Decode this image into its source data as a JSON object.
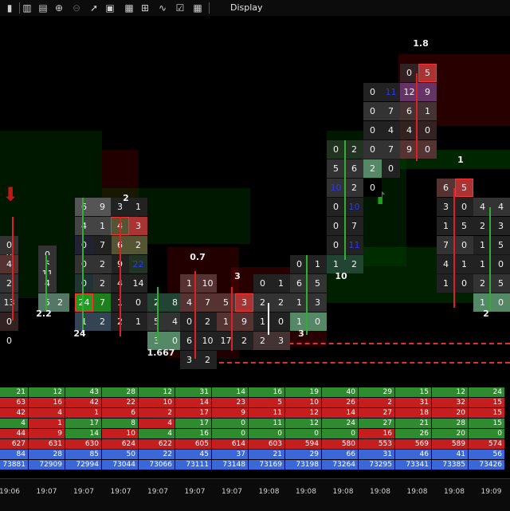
{
  "toolbar": {
    "title": "Display",
    "icons": [
      "bar-chart-icon",
      "zoom-in-icon",
      "zoom-out-icon",
      "pointer-icon",
      "notes-icon",
      "template-icon",
      "drawing-tool-icon",
      "checklist-icon",
      "grid-icon"
    ]
  },
  "colors": {
    "background": "#000000",
    "buy": "#2fae2f",
    "sell": "#e02020",
    "poc_box": "#ff3030",
    "delta_text_blue": "#1c2cff",
    "stat_green": "#2e8b2e",
    "stat_red": "#c41e1e",
    "stat_blue": "#3a68d8"
  },
  "chart": {
    "arrows": [
      {
        "direction": "down",
        "color": "#c01818"
      },
      {
        "direction": "up",
        "color": "#1fa01f"
      }
    ],
    "labels": [
      "1.8",
      "2",
      "0.7",
      "3",
      "2.2",
      "24",
      "1.667",
      "10",
      "3",
      "1",
      "2"
    ],
    "cells": [
      [
        "6",
        "9",
        "3",
        "1",
        "4",
        "1",
        "4",
        "3",
        "6",
        "2",
        "0",
        "7",
        "9",
        "22",
        "0",
        "2",
        "0",
        "2",
        "4",
        "14",
        "24",
        "7",
        "1",
        "0",
        "1",
        "2",
        "2",
        "1"
      ],
      [
        "0",
        "1",
        "0",
        "5",
        "11",
        "4",
        "5",
        "2"
      ],
      [
        "4",
        "0",
        "3",
        "4",
        "5",
        "2",
        "4",
        "13",
        "3",
        "0",
        "2",
        "0"
      ],
      [
        "2",
        "8",
        "5",
        "4",
        "3",
        "0"
      ],
      [
        "1",
        "10",
        "4",
        "7",
        "0",
        "2",
        "6",
        "10",
        "3",
        "2"
      ],
      [
        "5",
        "3",
        "1",
        "9",
        "17",
        "2"
      ],
      [
        "0",
        "1",
        "2",
        "2",
        "1",
        "0",
        "2",
        "3"
      ],
      [
        "0",
        "1",
        "6",
        "5",
        "1",
        "3",
        "1",
        "0"
      ],
      [
        "0",
        "2",
        "5",
        "6",
        "10",
        "2",
        "0",
        "10",
        "0",
        "7",
        "0",
        "11",
        "1",
        "2"
      ],
      [
        "2",
        "0",
        "0"
      ],
      [
        "0",
        "5",
        "0",
        "11",
        "12",
        "9",
        "0",
        "7",
        "6",
        "1",
        "0",
        "4",
        "4",
        "0",
        "0",
        "7",
        "9",
        "0"
      ],
      [
        "6",
        "5",
        "3",
        "0",
        "1",
        "5",
        "7",
        "0",
        "4",
        "1",
        "1",
        "0"
      ],
      [
        "4",
        "4",
        "2",
        "3",
        "1",
        "5",
        "1",
        "0",
        "2",
        "5",
        "1",
        "0"
      ]
    ]
  },
  "stats": {
    "rows": [
      [
        "21",
        "12",
        "43",
        "28",
        "12",
        "31",
        "14",
        "16",
        "19",
        "40",
        "29",
        "15",
        "12",
        "24"
      ],
      [
        "63",
        "16",
        "42",
        "22",
        "10",
        "14",
        "23",
        "5",
        "10",
        "26",
        "2",
        "31",
        "32",
        "15"
      ],
      [
        "42",
        "4",
        "1",
        "6",
        "2",
        "17",
        "9",
        "11",
        "12",
        "14",
        "27",
        "18",
        "20",
        "15"
      ],
      [
        "4",
        "1",
        "17",
        "8",
        "4",
        "17",
        "0",
        "11",
        "12",
        "24",
        "27",
        "21",
        "28",
        "15"
      ],
      [
        "44",
        "9",
        "14",
        "10",
        "4",
        "16",
        "0",
        "0",
        "0",
        "0",
        "16",
        "26",
        "20",
        "0"
      ],
      [
        "627",
        "631",
        "630",
        "624",
        "622",
        "605",
        "614",
        "603",
        "594",
        "580",
        "553",
        "569",
        "589",
        "574"
      ],
      [
        "84",
        "28",
        "85",
        "50",
        "22",
        "45",
        "37",
        "21",
        "29",
        "66",
        "31",
        "46",
        "41",
        "56"
      ],
      [
        "73881",
        "72909",
        "72994",
        "73044",
        "73066",
        "73111",
        "73148",
        "73169",
        "73198",
        "73264",
        "73295",
        "73341",
        "73385",
        "73426"
      ]
    ]
  },
  "time_axis": [
    "19:06",
    "19:07",
    "19:07",
    "19:07",
    "19:07",
    "19:07",
    "19:07",
    "19:08",
    "19:08",
    "19:08",
    "19:08",
    "19:08",
    "19:08",
    "19:09"
  ]
}
